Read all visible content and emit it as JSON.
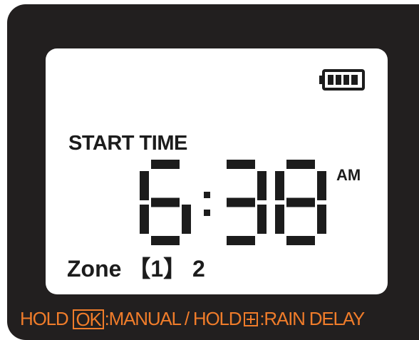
{
  "display": {
    "battery_icon": "battery-full-icon",
    "label": "START TIME",
    "time": {
      "hour": "6",
      "minute_tens": "3",
      "minute_ones": "8"
    },
    "meridiem": "AM",
    "zone_prefix": "Zone",
    "zone_selected": "【1】",
    "zone_other": "2"
  },
  "footer": {
    "hold1": "HOLD",
    "key1": "OK",
    "action1": ":MANUAL / HOLD",
    "key2_icon": "plus-key-icon",
    "action2": ":RAIN DELAY"
  },
  "colors": {
    "body": "#221f1f",
    "screen": "#ffffff",
    "segment": "#1c1c1c",
    "accent": "#f07c2a"
  }
}
